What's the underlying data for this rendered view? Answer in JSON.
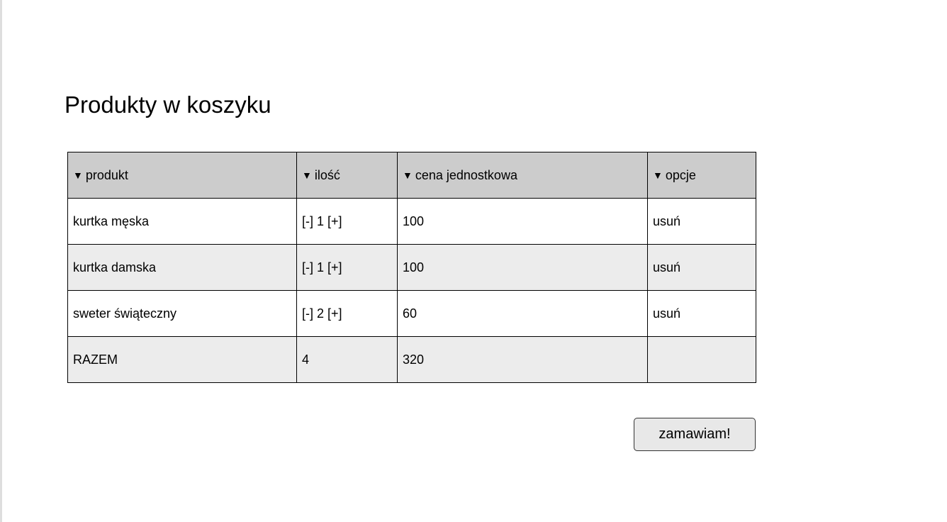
{
  "page": {
    "title": "Produkty w koszyku"
  },
  "icons": {
    "sort": "▼"
  },
  "table": {
    "headers": [
      "produkt",
      "ilość",
      "cena jednostkowa",
      "opcje"
    ],
    "rows": [
      {
        "product": "kurtka męska",
        "qty_minus": "[-]",
        "qty": "1",
        "qty_plus": "[+]",
        "price": "100",
        "option": "usuń"
      },
      {
        "product": "kurtka damska",
        "qty_minus": "[-]",
        "qty": "1",
        "qty_plus": "[+]",
        "price": "100",
        "option": "usuń"
      },
      {
        "product": "sweter świąteczny",
        "qty_minus": "[-]",
        "qty": "2",
        "qty_plus": "[+]",
        "price": "60",
        "option": "usuń"
      }
    ],
    "total": {
      "label": "RAZEM",
      "qty": "4",
      "price": "320"
    }
  },
  "actions": {
    "order_label": "zamawiam!"
  },
  "colors": {
    "header_bg": "#cccccc",
    "stripe_bg": "#ececec",
    "button_bg": "#e8e8e8"
  }
}
